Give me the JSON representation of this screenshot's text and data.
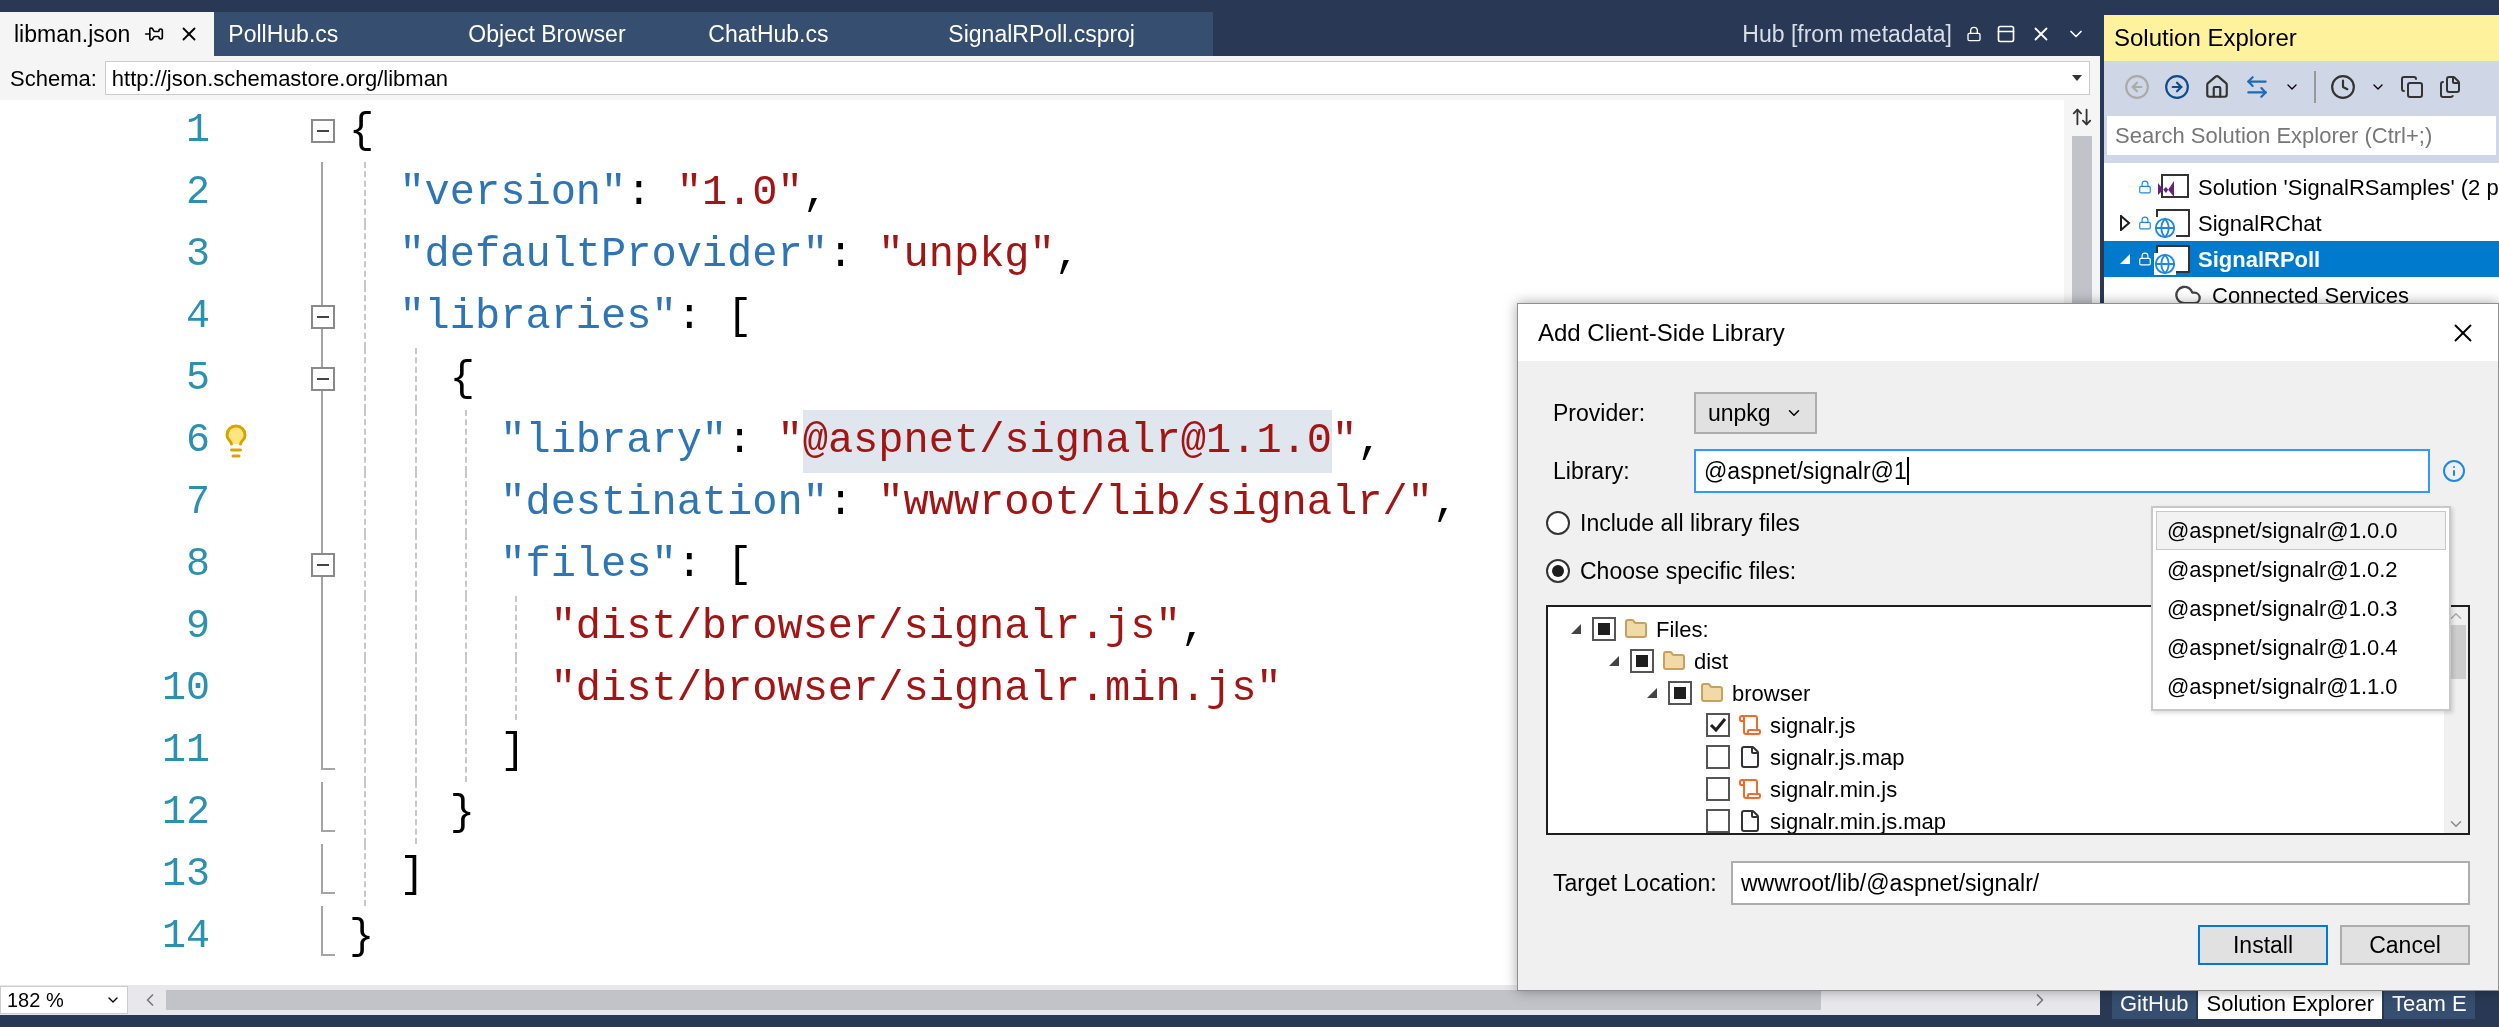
{
  "tabs": [
    {
      "label": "libman.json",
      "selected": true
    },
    {
      "label": "PollHub.cs",
      "selected": false
    },
    {
      "label": "Object Browser",
      "selected": false
    },
    {
      "label": "ChatHub.cs",
      "selected": false
    },
    {
      "label": "SignalRPoll.csproj",
      "selected": false
    }
  ],
  "preview_tab": {
    "label": "Hub [from metadata]"
  },
  "schema": {
    "label": "Schema:",
    "value": "http://json.schemastore.org/libman"
  },
  "editor": {
    "lines": [
      {
        "number": "1",
        "fold": true,
        "hint": false,
        "tokens": [
          {
            "kind": "open",
            "text": "{"
          }
        ]
      },
      {
        "number": "2",
        "fold": false,
        "hint": false,
        "tokens": [
          {
            "kind": "key",
            "text": "\"version\""
          },
          {
            "kind": "punct",
            "text": ": "
          },
          {
            "kind": "string",
            "text": "\"1.0\""
          },
          {
            "kind": "punct",
            "text": ","
          }
        ]
      },
      {
        "number": "3",
        "fold": false,
        "hint": false,
        "tokens": [
          {
            "kind": "key",
            "text": "\"defaultProvider\""
          },
          {
            "kind": "punct",
            "text": ": "
          },
          {
            "kind": "string",
            "text": "\"unpkg\""
          },
          {
            "kind": "punct",
            "text": ","
          }
        ]
      },
      {
        "number": "4",
        "fold": true,
        "hint": false,
        "tokens": [
          {
            "kind": "key",
            "text": "\"libraries\""
          },
          {
            "kind": "punct",
            "text": ": "
          },
          {
            "kind": "open",
            "text": "["
          }
        ]
      },
      {
        "number": "5",
        "fold": true,
        "hint": false,
        "tokens": [
          {
            "kind": "open",
            "text": "{"
          }
        ]
      },
      {
        "number": "6",
        "fold": false,
        "hint": true,
        "tokens": [
          {
            "kind": "key",
            "text": "\"library\""
          },
          {
            "kind": "punct",
            "text": ": "
          },
          {
            "kind": "string",
            "text": "\""
          },
          {
            "kind": "string",
            "text": "@aspnet/signalr@1.1.0",
            "highlighted": true
          },
          {
            "kind": "string",
            "text": "\""
          },
          {
            "kind": "punct",
            "text": ","
          }
        ]
      },
      {
        "number": "7",
        "fold": false,
        "hint": false,
        "tokens": [
          {
            "kind": "key",
            "text": "\"destination\""
          },
          {
            "kind": "punct",
            "text": ": "
          },
          {
            "kind": "string",
            "text": "\"wwwroot/lib/signalr/\""
          },
          {
            "kind": "punct",
            "text": ","
          }
        ]
      },
      {
        "number": "8",
        "fold": true,
        "hint": false,
        "tokens": [
          {
            "kind": "key",
            "text": "\"files\""
          },
          {
            "kind": "punct",
            "text": ": "
          },
          {
            "kind": "open",
            "text": "["
          }
        ]
      },
      {
        "number": "9",
        "fold": false,
        "hint": false,
        "tokens": [
          {
            "kind": "string",
            "text": "\"dist/browser/signalr.js\""
          },
          {
            "kind": "punct",
            "text": ","
          }
        ]
      },
      {
        "number": "10",
        "fold": false,
        "hint": false,
        "tokens": [
          {
            "kind": "string",
            "text": "\"dist/browser/signalr.min.js\""
          }
        ]
      },
      {
        "number": "11",
        "fold": false,
        "hint": false,
        "tokens": [
          {
            "kind": "close",
            "text": "]"
          }
        ]
      },
      {
        "number": "12",
        "fold": false,
        "hint": false,
        "tokens": [
          {
            "kind": "close",
            "text": "}"
          }
        ]
      },
      {
        "number": "13",
        "fold": false,
        "hint": false,
        "tokens": [
          {
            "kind": "close",
            "text": "]"
          }
        ]
      },
      {
        "number": "14",
        "fold": false,
        "hint": false,
        "tokens": [
          {
            "kind": "close",
            "text": "}"
          }
        ]
      }
    ]
  },
  "zoom": "182 %",
  "solution_explorer": {
    "title": "Solution Explorer",
    "search": {
      "placeholder": "Search Solution Explorer (Ctrl+;)"
    },
    "tree": [
      {
        "label": "Solution 'SignalRSamples' (2 p",
        "kind": "solution",
        "selected": false,
        "children": [
          {
            "label": "SignalRChat",
            "kind": "project",
            "selected": false,
            "expanded": false
          },
          {
            "label": "SignalRPoll",
            "kind": "project",
            "selected": true,
            "expanded": true,
            "children": [
              {
                "label": "Connected Services",
                "kind": "service",
                "selected": false
              }
            ]
          }
        ]
      }
    ]
  },
  "bottom_tabs": [
    {
      "label": "GitHub",
      "selected": false
    },
    {
      "label": "Solution Explorer",
      "selected": true
    },
    {
      "label": "Team E",
      "selected": false
    }
  ],
  "dialog": {
    "title": "Add Client-Side Library",
    "provider": {
      "label": "Provider:",
      "value": "unpkg"
    },
    "library": {
      "label": "Library:",
      "value": "@aspnet/signalr@1"
    },
    "options": [
      {
        "label": "Include all library files",
        "selected": false
      },
      {
        "label": "Choose specific files:",
        "selected": true
      }
    ],
    "files": [
      {
        "label": "Files:",
        "kind": "folder",
        "indeterminate": true,
        "expanded": true,
        "children": [
          {
            "label": "dist",
            "kind": "folder",
            "indeterminate": true,
            "expanded": true,
            "children": [
              {
                "label": "browser",
                "kind": "folder",
                "indeterminate": true,
                "expanded": true,
                "children": [
                  {
                    "label": "signalr.js",
                    "kind": "script",
                    "checked": true
                  },
                  {
                    "label": "signalr.js.map",
                    "kind": "file",
                    "checked": false
                  },
                  {
                    "label": "signalr.min.js",
                    "kind": "script",
                    "checked": false
                  },
                  {
                    "label": "signalr.min.js.map",
                    "kind": "file",
                    "checked": false
                  }
                ]
              }
            ]
          }
        ]
      }
    ],
    "suggestions": [
      {
        "label": "@aspnet/signalr@1.0.0",
        "selected": true
      },
      {
        "label": "@aspnet/signalr@1.0.2",
        "selected": false
      },
      {
        "label": "@aspnet/signalr@1.0.3",
        "selected": false
      },
      {
        "label": "@aspnet/signalr@1.0.4",
        "selected": false
      },
      {
        "label": "@aspnet/signalr@1.1.0",
        "selected": false
      }
    ],
    "target": {
      "label": "Target Location:",
      "value": "wwwroot/lib/@aspnet/signalr/"
    },
    "buttons": [
      {
        "label": "Install",
        "default": true
      },
      {
        "label": "Cancel",
        "default": false
      }
    ]
  }
}
